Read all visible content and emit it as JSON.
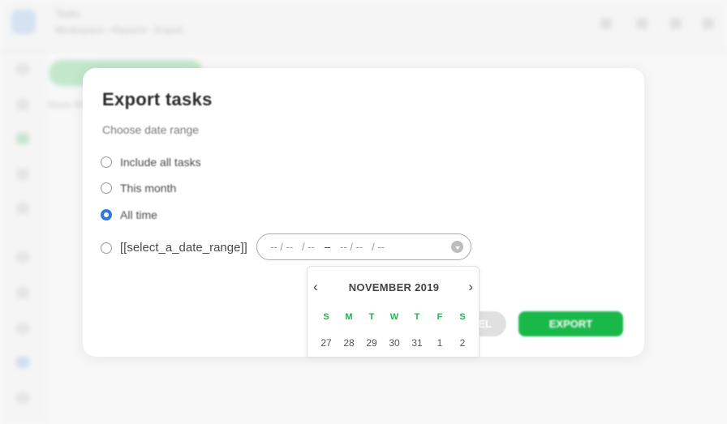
{
  "background": {
    "app_title": "Tasks",
    "app_subtitle": "Workspace › Reports › Export",
    "side_text": "Show W"
  },
  "modal": {
    "title": "Export tasks",
    "subtitle": "Choose date range",
    "options": [
      {
        "label": "Include all tasks",
        "checked": false
      },
      {
        "label": "This month",
        "checked": false
      },
      {
        "label": "All time",
        "checked": true
      },
      {
        "label": "[[select_a_date_range]]",
        "checked": false
      }
    ],
    "date_range": {
      "start": "-- / --   / --",
      "separator": "–",
      "end": "-- / --   / --"
    },
    "cancel_label": "EL",
    "confirm_label": "EXPORT"
  },
  "calendar": {
    "month_label": "NOVEMBER 2019",
    "prev_label": "‹",
    "next_label": "›",
    "weekdays": [
      "S",
      "M",
      "T",
      "W",
      "T",
      "F",
      "S"
    ],
    "days": [
      "27",
      "28",
      "29",
      "30",
      "31",
      "1",
      "2"
    ]
  },
  "colors": {
    "accent_green": "#1ab84a",
    "radio_blue": "#2e7be0"
  }
}
